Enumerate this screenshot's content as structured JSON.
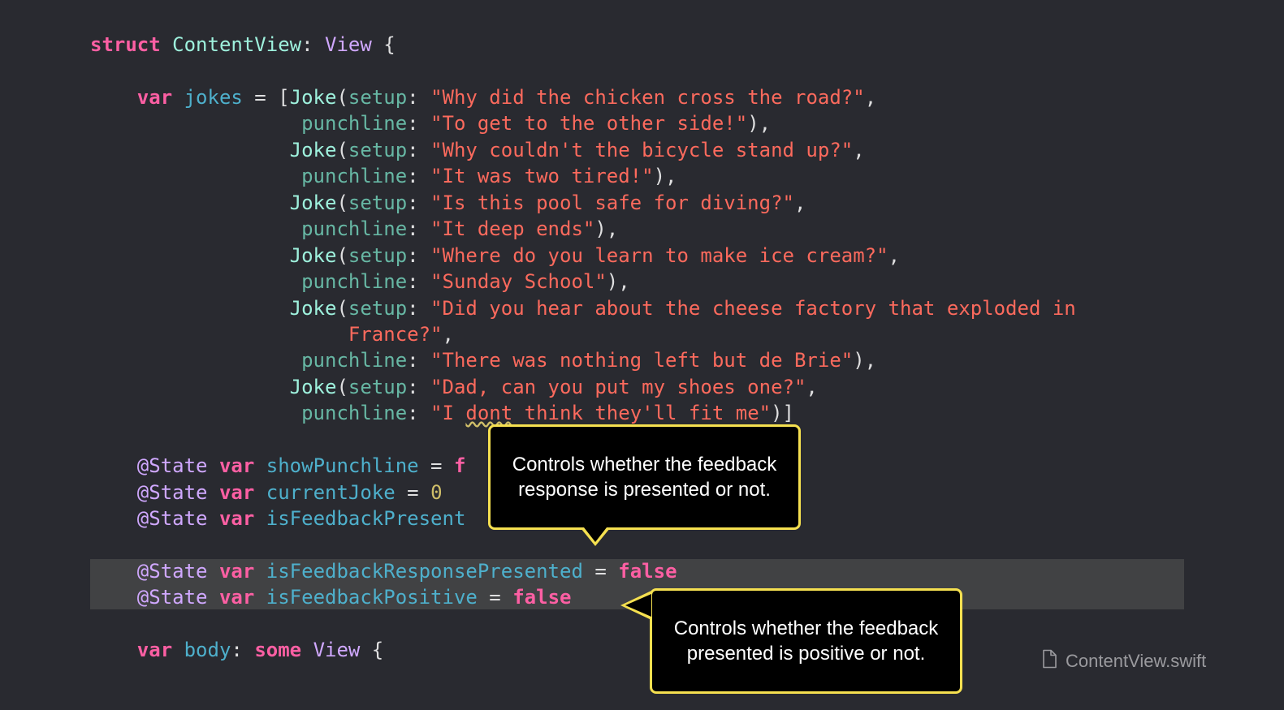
{
  "code": {
    "lines": [
      [
        [
          "kw",
          "struct"
        ],
        [
          "plain",
          " "
        ],
        [
          "cls",
          "ContentView"
        ],
        [
          "plain",
          ": "
        ],
        [
          "ty",
          "View"
        ],
        [
          "plain",
          " {"
        ]
      ],
      [],
      [
        [
          "plain",
          "    "
        ],
        [
          "kw",
          "var"
        ],
        [
          "plain",
          " "
        ],
        [
          "prop",
          "jokes"
        ],
        [
          "plain",
          " = ["
        ],
        [
          "cls",
          "Joke"
        ],
        [
          "plain",
          "("
        ],
        [
          "lb",
          "setup"
        ],
        [
          "plain",
          ": "
        ],
        [
          "str",
          "\"Why did the chicken cross the road?\""
        ],
        [
          "plain",
          ","
        ]
      ],
      [
        [
          "plain",
          "                  "
        ],
        [
          "lb",
          "punchline"
        ],
        [
          "plain",
          ": "
        ],
        [
          "str",
          "\"To get to the other side!\""
        ],
        [
          "plain",
          "),"
        ]
      ],
      [
        [
          "plain",
          "                 "
        ],
        [
          "cls",
          "Joke"
        ],
        [
          "plain",
          "("
        ],
        [
          "lb",
          "setup"
        ],
        [
          "plain",
          ": "
        ],
        [
          "str",
          "\"Why couldn't the bicycle stand up?\""
        ],
        [
          "plain",
          ","
        ]
      ],
      [
        [
          "plain",
          "                  "
        ],
        [
          "lb",
          "punchline"
        ],
        [
          "plain",
          ": "
        ],
        [
          "str",
          "\"It was two tired!\""
        ],
        [
          "plain",
          "),"
        ]
      ],
      [
        [
          "plain",
          "                 "
        ],
        [
          "cls",
          "Joke"
        ],
        [
          "plain",
          "("
        ],
        [
          "lb",
          "setup"
        ],
        [
          "plain",
          ": "
        ],
        [
          "str",
          "\"Is this pool safe for diving?\""
        ],
        [
          "plain",
          ","
        ]
      ],
      [
        [
          "plain",
          "                  "
        ],
        [
          "lb",
          "punchline"
        ],
        [
          "plain",
          ": "
        ],
        [
          "str",
          "\"It deep ends\""
        ],
        [
          "plain",
          "),"
        ]
      ],
      [
        [
          "plain",
          "                 "
        ],
        [
          "cls",
          "Joke"
        ],
        [
          "plain",
          "("
        ],
        [
          "lb",
          "setup"
        ],
        [
          "plain",
          ": "
        ],
        [
          "str",
          "\"Where do you learn to make ice cream?\""
        ],
        [
          "plain",
          ","
        ]
      ],
      [
        [
          "plain",
          "                  "
        ],
        [
          "lb",
          "punchline"
        ],
        [
          "plain",
          ": "
        ],
        [
          "str",
          "\"Sunday School\""
        ],
        [
          "plain",
          "),"
        ]
      ],
      [
        [
          "plain",
          "                 "
        ],
        [
          "cls",
          "Joke"
        ],
        [
          "plain",
          "("
        ],
        [
          "lb",
          "setup"
        ],
        [
          "plain",
          ": "
        ],
        [
          "str",
          "\"Did you hear about the cheese factory that exploded in"
        ]
      ],
      [
        [
          "plain",
          "                      "
        ],
        [
          "str",
          "France?\""
        ],
        [
          "plain",
          ","
        ]
      ],
      [
        [
          "plain",
          "                  "
        ],
        [
          "lb",
          "punchline"
        ],
        [
          "plain",
          ": "
        ],
        [
          "str",
          "\"There was nothing left but de Brie\""
        ],
        [
          "plain",
          "),"
        ]
      ],
      [
        [
          "plain",
          "                 "
        ],
        [
          "cls",
          "Joke"
        ],
        [
          "plain",
          "("
        ],
        [
          "lb",
          "setup"
        ],
        [
          "plain",
          ": "
        ],
        [
          "str",
          "\"Dad, can you put my shoes one?\""
        ],
        [
          "plain",
          ","
        ]
      ],
      [
        [
          "plain",
          "                  "
        ],
        [
          "lb",
          "punchline"
        ],
        [
          "plain",
          ": "
        ],
        [
          "str",
          "\"I "
        ],
        [
          "str squig",
          "dont"
        ],
        [
          "str",
          " think they'll fit me\""
        ],
        [
          "plain",
          ")]"
        ]
      ],
      [],
      [
        [
          "plain",
          "    "
        ],
        [
          "attr",
          "@State"
        ],
        [
          "plain",
          " "
        ],
        [
          "kw",
          "var"
        ],
        [
          "plain",
          " "
        ],
        [
          "prop",
          "showPunchline"
        ],
        [
          "plain",
          " = "
        ],
        [
          "kw",
          "f"
        ]
      ],
      [
        [
          "plain",
          "    "
        ],
        [
          "attr",
          "@State"
        ],
        [
          "plain",
          " "
        ],
        [
          "kw",
          "var"
        ],
        [
          "plain",
          " "
        ],
        [
          "prop",
          "currentJoke"
        ],
        [
          "plain",
          " = "
        ],
        [
          "num",
          "0"
        ]
      ],
      [
        [
          "plain",
          "    "
        ],
        [
          "attr",
          "@State"
        ],
        [
          "plain",
          " "
        ],
        [
          "kw",
          "var"
        ],
        [
          "plain",
          " "
        ],
        [
          "prop",
          "isFeedbackPresent"
        ]
      ],
      [],
      [
        [
          "plain",
          "    "
        ],
        [
          "attr",
          "@State"
        ],
        [
          "plain",
          " "
        ],
        [
          "kw",
          "var"
        ],
        [
          "plain",
          " "
        ],
        [
          "prop",
          "isFeedbackResponsePresented"
        ],
        [
          "plain",
          " = "
        ],
        [
          "kw",
          "false"
        ]
      ],
      [
        [
          "plain",
          "    "
        ],
        [
          "attr",
          "@State"
        ],
        [
          "plain",
          " "
        ],
        [
          "kw",
          "var"
        ],
        [
          "plain",
          " "
        ],
        [
          "prop",
          "isFeedbackPositive"
        ],
        [
          "plain",
          " = "
        ],
        [
          "kw",
          "false"
        ]
      ],
      [],
      [
        [
          "plain",
          "    "
        ],
        [
          "kw",
          "var"
        ],
        [
          "plain",
          " "
        ],
        [
          "prop",
          "body"
        ],
        [
          "plain",
          ": "
        ],
        [
          "kw",
          "some"
        ],
        [
          "plain",
          " "
        ],
        [
          "ty",
          "View"
        ],
        [
          "plain",
          " {"
        ]
      ]
    ]
  },
  "callouts": {
    "top": {
      "line1": "Controls whether the feedback",
      "line2": "response is presented or not."
    },
    "bottom": {
      "line1": "Controls whether the feedback",
      "line2": "presented is positive or not."
    }
  },
  "file": {
    "name": "ContentView.swift",
    "icon": "document-icon"
  }
}
